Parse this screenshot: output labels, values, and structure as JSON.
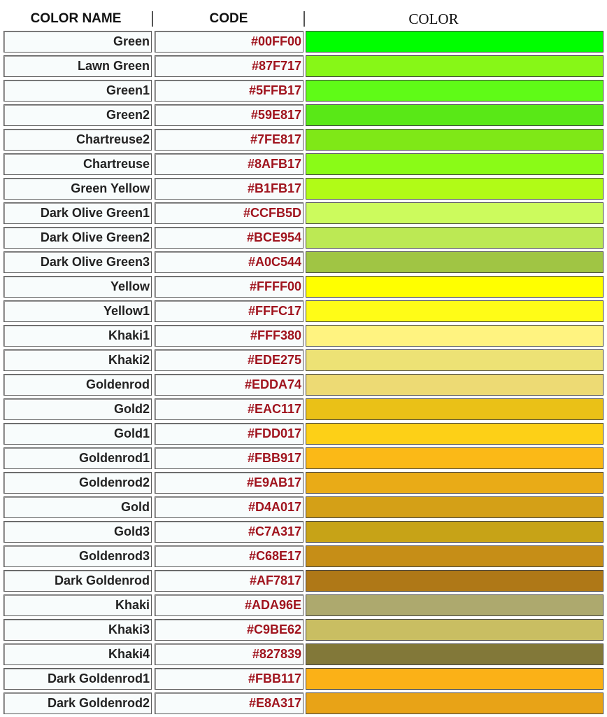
{
  "header": {
    "name_label": "COLOR NAME",
    "code_label": "CODE",
    "color_label": "COLOR"
  },
  "rows": [
    {
      "name": "Green",
      "code": "#00FF00",
      "swatch": "#00FF00"
    },
    {
      "name": "Lawn Green",
      "code": "#87F717",
      "swatch": "#87F717"
    },
    {
      "name": "Green1",
      "code": "#5FFB17",
      "swatch": "#5FFB17"
    },
    {
      "name": "Green2",
      "code": "#59E817",
      "swatch": "#59E817"
    },
    {
      "name": "Chartreuse2",
      "code": "#7FE817",
      "swatch": "#7FE817"
    },
    {
      "name": "Chartreuse",
      "code": "#8AFB17",
      "swatch": "#8AFB17"
    },
    {
      "name": "Green Yellow",
      "code": "#B1FB17",
      "swatch": "#B1FB17"
    },
    {
      "name": "Dark Olive Green1",
      "code": "#CCFB5D",
      "swatch": "#CCFB5D"
    },
    {
      "name": "Dark Olive Green2",
      "code": "#BCE954",
      "swatch": "#BCE954"
    },
    {
      "name": "Dark Olive Green3",
      "code": "#A0C544",
      "swatch": "#A0C544"
    },
    {
      "name": "Yellow",
      "code": "#FFFF00",
      "swatch": "#FFFF00"
    },
    {
      "name": "Yellow1",
      "code": "#FFFC17",
      "swatch": "#FFFC17"
    },
    {
      "name": "Khaki1",
      "code": "#FFF380",
      "swatch": "#FFF380"
    },
    {
      "name": "Khaki2",
      "code": "#EDE275",
      "swatch": "#EDE275"
    },
    {
      "name": "Goldenrod",
      "code": "#EDDA74",
      "swatch": "#EDDA74"
    },
    {
      "name": "Gold2",
      "code": "#EAC117",
      "swatch": "#EAC117"
    },
    {
      "name": "Gold1",
      "code": "#FDD017",
      "swatch": "#FDD017"
    },
    {
      "name": "Goldenrod1",
      "code": "#FBB917",
      "swatch": "#FBB917"
    },
    {
      "name": "Goldenrod2",
      "code": "#E9AB17",
      "swatch": "#E9AB17"
    },
    {
      "name": "Gold",
      "code": "#D4A017",
      "swatch": "#D4A017"
    },
    {
      "name": "Gold3",
      "code": "#C7A317",
      "swatch": "#C7A317"
    },
    {
      "name": "Goldenrod3",
      "code": "#C68E17",
      "swatch": "#C68E17"
    },
    {
      "name": "Dark Goldenrod",
      "code": "#AF7817",
      "swatch": "#AF7817"
    },
    {
      "name": "Khaki",
      "code": "#ADA96E",
      "swatch": "#ADA96E"
    },
    {
      "name": "Khaki3",
      "code": "#C9BE62",
      "swatch": "#C9BE62"
    },
    {
      "name": "Khaki4",
      "code": "#827839",
      "swatch": "#827839"
    },
    {
      "name": "Dark Goldenrod1",
      "code": "#FBB117",
      "swatch": "#FBB117"
    },
    {
      "name": "Dark Goldenrod2",
      "code": "#E8A317",
      "swatch": "#E8A317"
    }
  ]
}
